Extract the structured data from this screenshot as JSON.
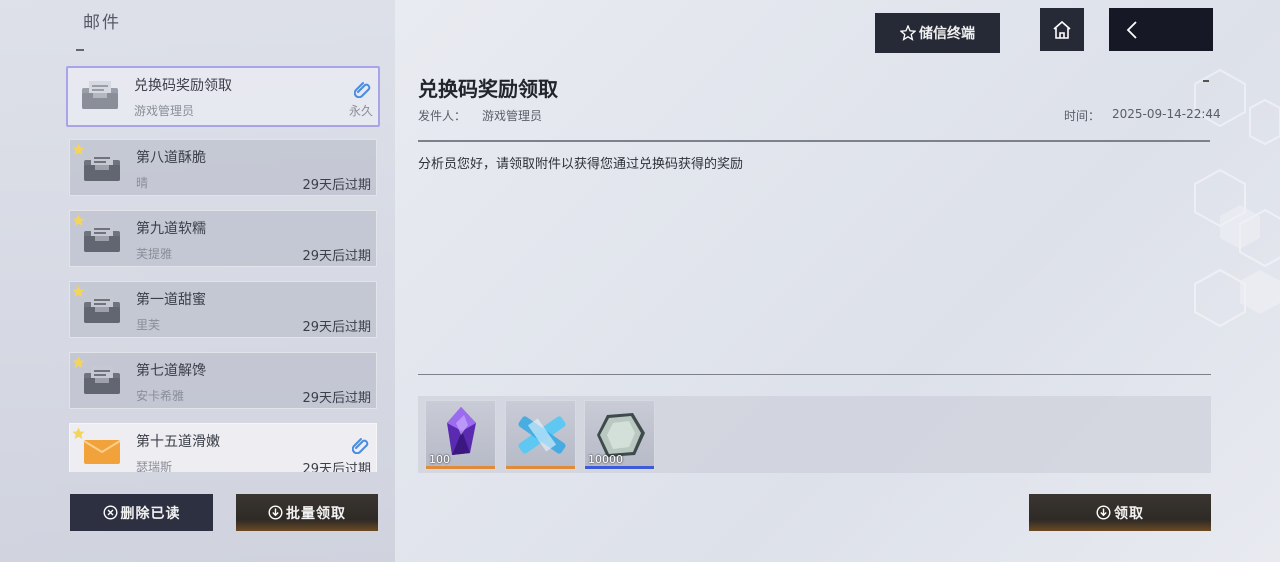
{
  "page": {
    "title": "邮件"
  },
  "top_bar": {
    "terminal_label": "储信终端"
  },
  "mails": [
    {
      "subject": "兑换码奖励领取",
      "sender": "游戏管理员",
      "expire": "永久",
      "selected": true,
      "starred": false,
      "attachment": true,
      "icon": "tray-icon"
    },
    {
      "subject": "第八道酥脆",
      "sender": "晴",
      "expire": "29天后过期",
      "selected": false,
      "starred": true,
      "attachment": false,
      "icon": "tray-icon"
    },
    {
      "subject": "第九道软糯",
      "sender": "芙提雅",
      "expire": "29天后过期",
      "selected": false,
      "starred": true,
      "attachment": false,
      "icon": "tray-icon"
    },
    {
      "subject": "第一道甜蜜",
      "sender": "里芙",
      "expire": "29天后过期",
      "selected": false,
      "starred": true,
      "attachment": false,
      "icon": "tray-icon"
    },
    {
      "subject": "第七道解馋",
      "sender": "安卡希雅",
      "expire": "29天后过期",
      "selected": false,
      "starred": true,
      "attachment": false,
      "icon": "tray-icon"
    },
    {
      "subject": "第十五道滑嫩",
      "sender": "瑟瑞斯",
      "expire": "29天后过期",
      "selected": false,
      "starred": true,
      "attachment": true,
      "icon": "envelope-icon"
    }
  ],
  "actions": {
    "delete_read": "删除已读",
    "claim_all": "批量领取",
    "claim": "领取"
  },
  "detail": {
    "title": "兑换码奖励领取",
    "sender_label": "发件人：",
    "sender": "游戏管理员",
    "time_label": "时间：",
    "time": "2025-09-14-22:44",
    "body": "分析员您好，请领取附件以获得您通过兑换码获得的奖励"
  },
  "attachments": [
    {
      "name": "purple-crystal-icon",
      "qty": "100",
      "rarity_color": "#e08a3c"
    },
    {
      "name": "blue-ticket-icon",
      "qty": "",
      "rarity_color": "#e08a3c"
    },
    {
      "name": "silver-coin-icon",
      "qty": "10000",
      "rarity_color": "#3d5bd9"
    }
  ]
}
